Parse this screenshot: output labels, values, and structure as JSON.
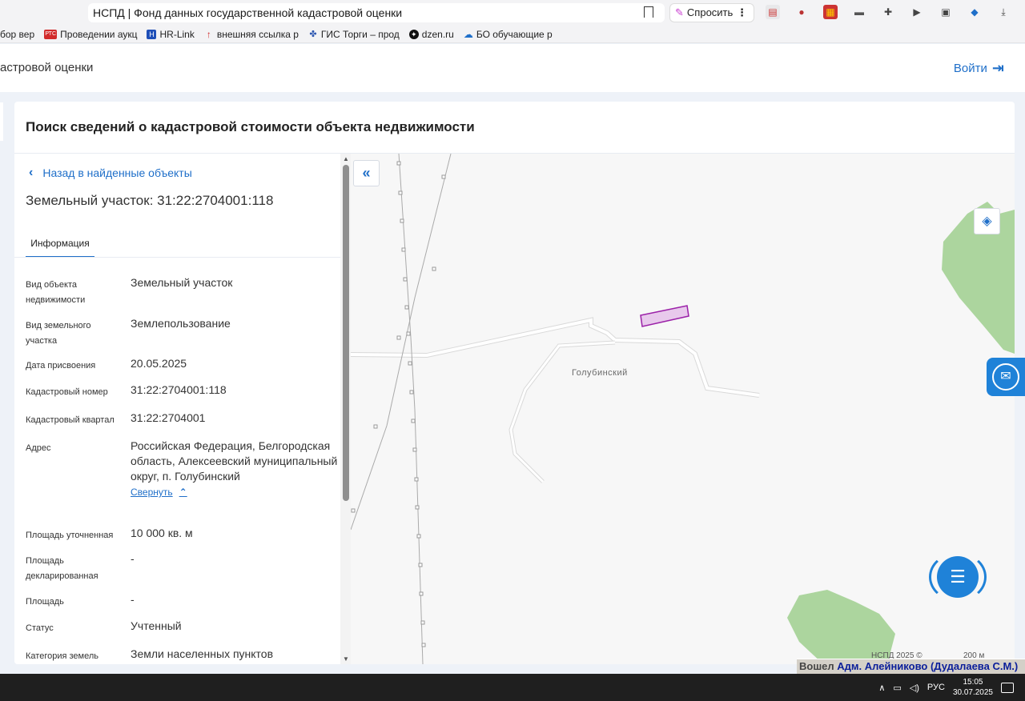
{
  "browser": {
    "tab_title": "НСПД | Фонд данных государственной кадастровой оценки",
    "ask_label": "Спросить",
    "bookmarks": [
      {
        "label": "бор вер",
        "icon": "doc-icon",
        "color": "#888888"
      },
      {
        "label": "Проведении аукц",
        "icon": "rts-icon",
        "color": "#d22b2b"
      },
      {
        "label": "HR-Link",
        "icon": "hr-link-icon",
        "color": "#1f4fb8"
      },
      {
        "label": "внешняя ссылка р",
        "icon": "arrow-up-icon",
        "color": "#d22b2b"
      },
      {
        "label": "ГИС Торги – прод",
        "icon": "emblem-icon",
        "color": "#2a55b0"
      },
      {
        "label": "dzen.ru",
        "icon": "dzen-icon",
        "color": "#111111"
      },
      {
        "label": "БО обучающие р",
        "icon": "cloud-icon",
        "color": "#1f6fc9"
      }
    ]
  },
  "header": {
    "site_name": "астровой оценки",
    "login_label": "Войти"
  },
  "card": {
    "title": "Поиск сведений о кадастровой стоимости объекта недвижимости"
  },
  "info": {
    "back_label": "Назад в найденные объекты",
    "object_title": "Земельный участок: 31:22:2704001:118",
    "tab_label": "Информация",
    "collapse_label": "Свернуть",
    "rows": [
      {
        "label": "Вид объекта недвижимости",
        "value": "Земельный участок"
      },
      {
        "label": "Вид земельного участка",
        "value": "Землепользование"
      },
      {
        "label": "Дата присвоения",
        "value": "20.05.2025"
      },
      {
        "label": "Кадастровый номер",
        "value": "31:22:2704001:118"
      },
      {
        "label": "Кадастровый квартал",
        "value": "31:22:2704001"
      },
      {
        "label": "Адрес",
        "value": "Российская Федерация, Белгородская область, Алексеевский муниципальный округ, п. Голубинский"
      },
      {
        "label": "Площадь уточненная",
        "value": "10 000 кв. м"
      },
      {
        "label": "Площадь декларированная",
        "value": "-"
      },
      {
        "label": "Площадь",
        "value": "-"
      },
      {
        "label": "Статус",
        "value": "Учтенный"
      },
      {
        "label": "Категория земель",
        "value": "Земли населенных пунктов"
      }
    ]
  },
  "map": {
    "place_label": "Голубинский",
    "credit": "НСПД 2025 ©",
    "scale_label": "200 м",
    "colors": {
      "background": "#f7f7f7",
      "forest": "#9fcf8e",
      "parcel_fill": "#e8c9ec",
      "parcel_stroke": "#9b21a8",
      "road": "#d9d9d9"
    }
  },
  "os": {
    "logged_prefix": "Вошел",
    "logged_user": "Адм. Алейниково (Дудалаева С.М.)",
    "lang": "РУС",
    "time": "15:05",
    "date": "30.07.2025"
  }
}
